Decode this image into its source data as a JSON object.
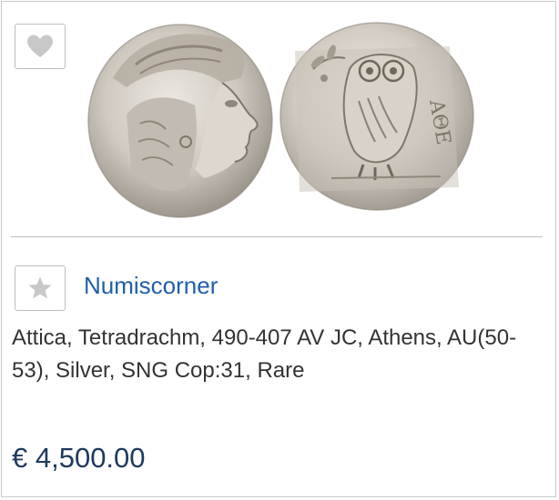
{
  "listing": {
    "favorite_icon": "heart-icon",
    "image_alt": "Athenian tetradrachm coin: obverse with helmeted head of Athena, reverse with owl and olive sprig",
    "seller": {
      "icon": "star-icon",
      "name": "Numiscorner"
    },
    "description": "Attica, Tetradrachm, 490-407 AV JC, Athens, AU(50-53), Silver, SNG Cop:31, Rare",
    "price": "€ 4,500.00"
  },
  "colors": {
    "link": "#1f5fa8",
    "price": "#1d3a5e",
    "icon_gray": "#c8c8c8",
    "border": "#bdbdbd"
  }
}
